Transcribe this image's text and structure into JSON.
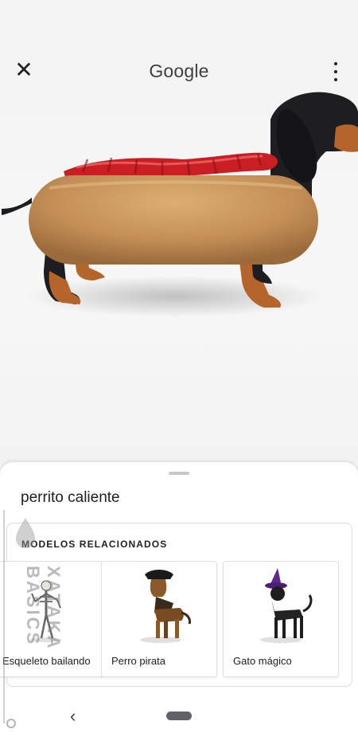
{
  "header": {
    "title": "Google",
    "close_icon": "close-icon",
    "more_icon": "more-vert-icon"
  },
  "viewer": {
    "model": "dachshund-hotdog-3d-model"
  },
  "sheet": {
    "query": "perrito caliente",
    "related": {
      "title": "MODELOS RELACIONADOS",
      "items": [
        {
          "label": "Esqueleto bailando",
          "icon": "skeleton-model"
        },
        {
          "label": "Perro pirata",
          "icon": "pirate-dog-model"
        },
        {
          "label": "Gato mágico",
          "icon": "magic-cat-model"
        }
      ]
    }
  },
  "watermark": {
    "text": "XATAKA BASICS"
  },
  "navbar": {
    "back_icon": "back-chevron-icon",
    "home_icon": "home-pill-icon"
  },
  "colors": {
    "bun": "#c9955a",
    "sausage": "#c81e24",
    "dog": "#1d1d22",
    "tan": "#b5652b"
  }
}
